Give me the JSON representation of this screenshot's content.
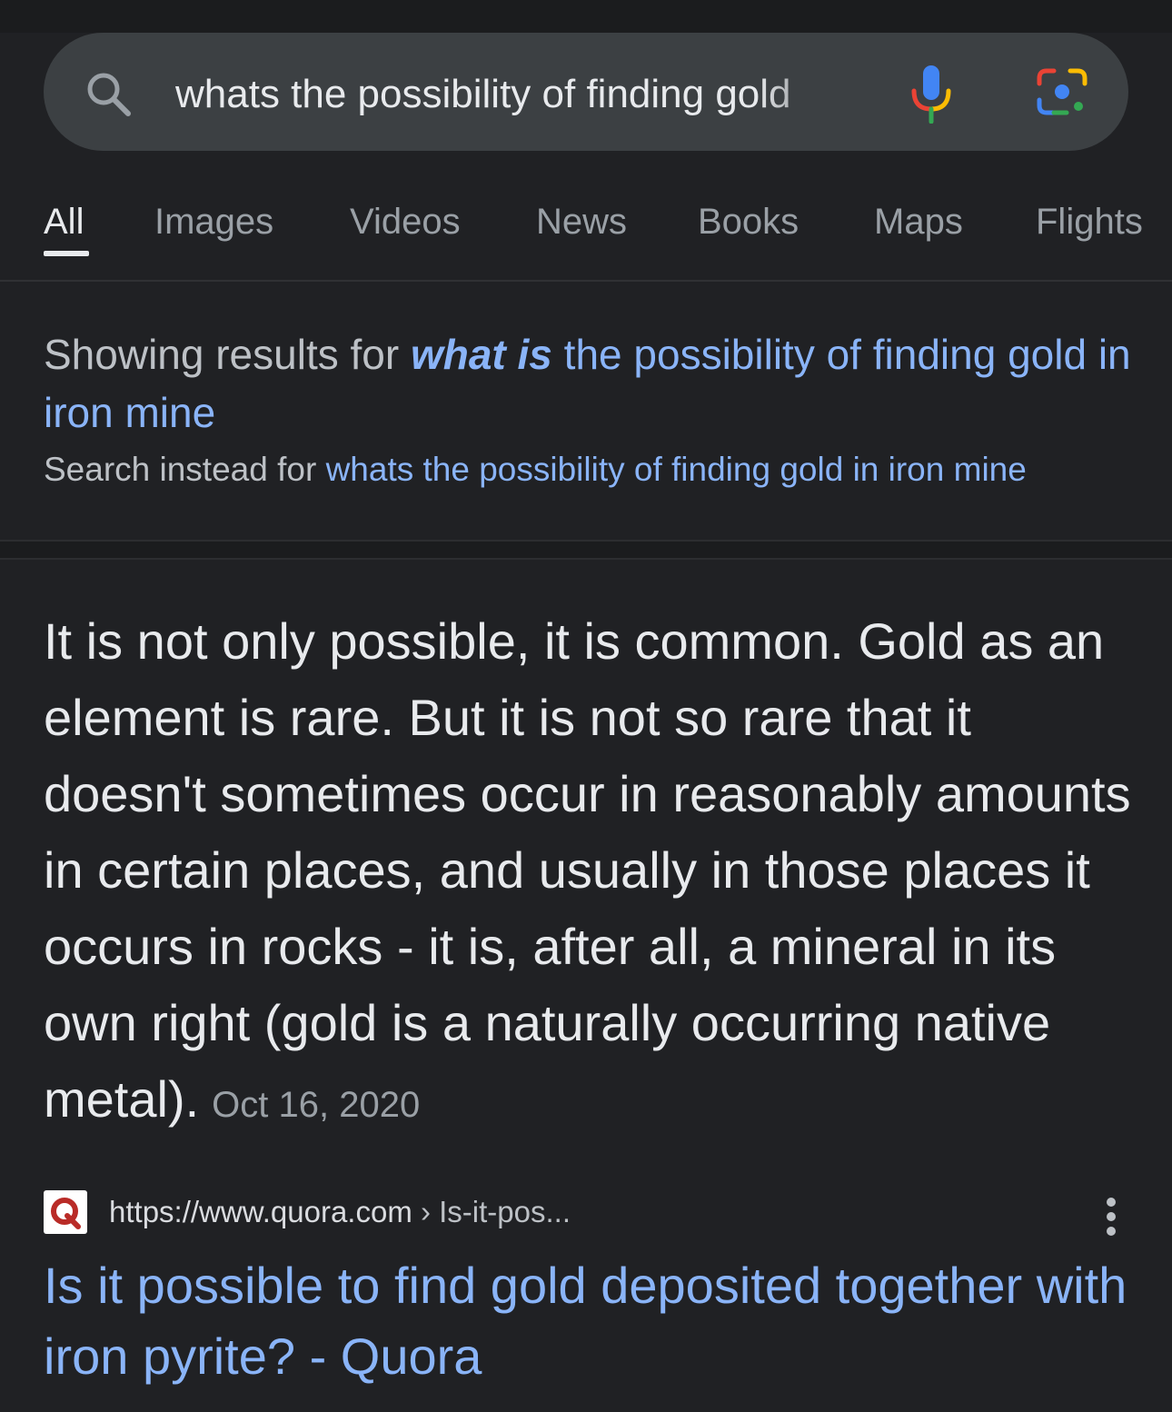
{
  "search": {
    "query": "whats the possibility of finding gold"
  },
  "tabs": [
    {
      "label": "All",
      "active": true
    },
    {
      "label": "Images"
    },
    {
      "label": "Videos"
    },
    {
      "label": "News"
    },
    {
      "label": "Books"
    },
    {
      "label": "Maps"
    },
    {
      "label": "Flights"
    }
  ],
  "correction": {
    "prefix": "Showing results for ",
    "emphasis": "what is",
    "rest": " the possibility of finding gold in iron mine",
    "instead_prefix": "Search instead for ",
    "instead_query": "whats the possibility of finding gold in iron mine"
  },
  "snippet": {
    "text": "It is not only possible, it is common. Gold as an element is rare. But it is not so rare that it doesn't sometimes occur in reasonably amounts in certain places, and usually in those places it occurs in rocks - it is, after all, a mineral in its own right (gold is a naturally occurring native metal).",
    "date": "Oct 16, 2020"
  },
  "source": {
    "url": "https://www.quora.com",
    "separator": " › ",
    "path": "Is-it-pos...",
    "title": "Is it possible to find gold deposited together with iron pyrite? - Quora"
  },
  "colors": {
    "background": "#202124",
    "link": "#8ab4f8",
    "text": "#e8eaed",
    "muted": "#9aa0a6",
    "quora_brand": "#b92b27"
  },
  "icons": [
    "search-icon",
    "mic-icon",
    "lens-icon",
    "quora-favicon",
    "more-vert-icon"
  ]
}
